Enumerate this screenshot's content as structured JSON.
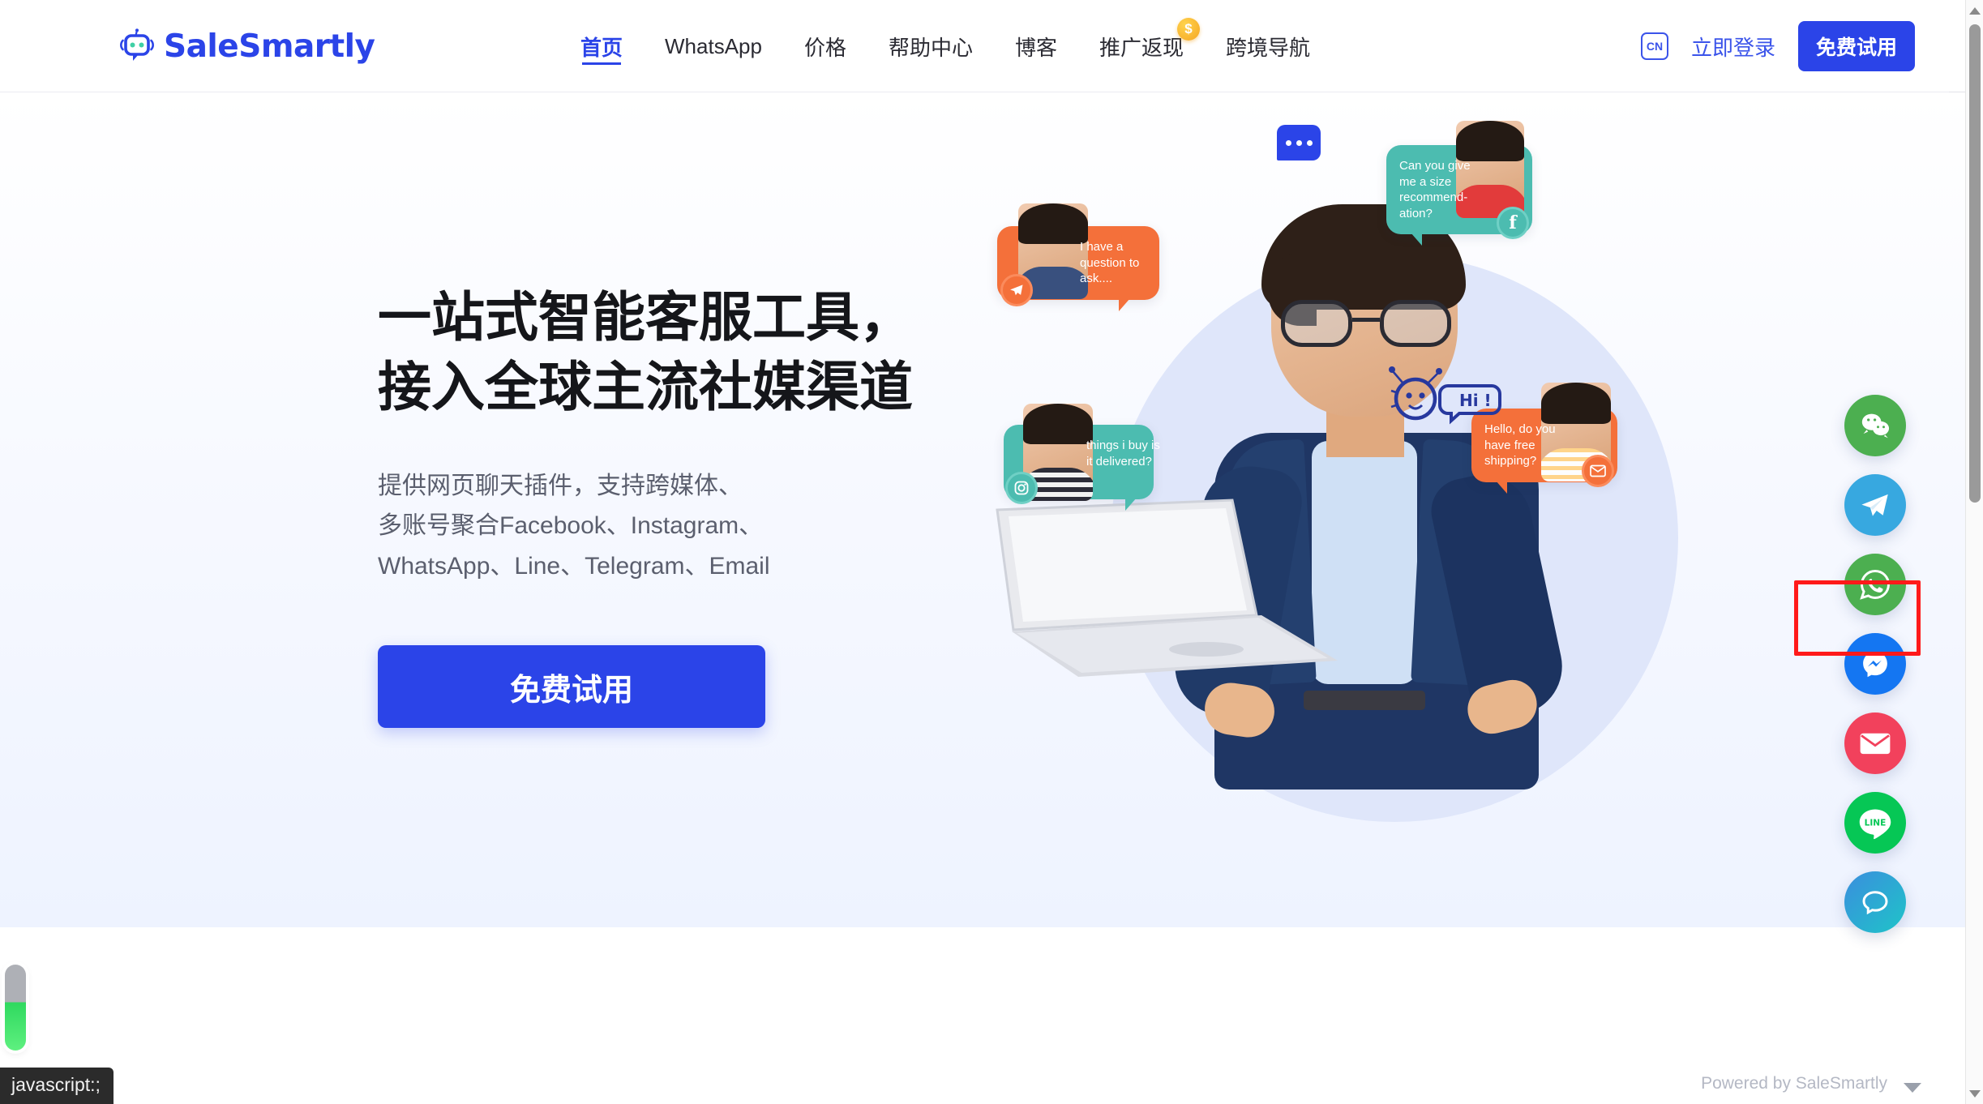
{
  "brand": {
    "name": "SaleSmartly",
    "logo_icon": "robot-logo-icon",
    "accent_color": "#2b44e8"
  },
  "header": {
    "nav": [
      {
        "label": "首页",
        "active": true,
        "badge": null
      },
      {
        "label": "WhatsApp",
        "active": false,
        "badge": null
      },
      {
        "label": "价格",
        "active": false,
        "badge": null
      },
      {
        "label": "帮助中心",
        "active": false,
        "badge": null
      },
      {
        "label": "博客",
        "active": false,
        "badge": null
      },
      {
        "label": "推广返现",
        "active": false,
        "badge": "$"
      },
      {
        "label": "跨境导航",
        "active": false,
        "badge": null
      }
    ],
    "language_label": "CN",
    "login_label": "立即登录",
    "trial_label": "免费试用"
  },
  "hero": {
    "title_line1": "一站式智能客服工具，",
    "title_line2": "接入全球主流社媒渠道",
    "sub_line1": "提供网页聊天插件，支持跨媒体、",
    "sub_line2": "多账号聚合Facebook、Instagram、",
    "sub_line3": "WhatsApp、Line、Telegram、Email",
    "cta_label": "免费试用",
    "bubbles": [
      {
        "id": "b1",
        "text": "I have a question to ask....",
        "color": "#f4703a",
        "channel": "telegram"
      },
      {
        "id": "b2",
        "text": "Can you give me a size recommend-ation?",
        "color": "#4cbcb0",
        "channel": "facebook"
      },
      {
        "id": "b3",
        "text": "things i buy is it delivered?",
        "color": "#4cbcb0",
        "channel": "instagram"
      },
      {
        "id": "b4",
        "text": "Hello, do you have free shipping?",
        "color": "#f4703a",
        "channel": "email"
      }
    ],
    "robot_greeting": "Hi !"
  },
  "social_rail": {
    "buttons": [
      {
        "name": "wechat",
        "icon": "wechat-icon",
        "color": "#4caf50",
        "highlighted": false
      },
      {
        "name": "telegram",
        "icon": "telegram-icon",
        "color": "#37a8e0",
        "highlighted": false
      },
      {
        "name": "whatsapp",
        "icon": "whatsapp-icon",
        "color": "#4caf50",
        "highlighted": true
      },
      {
        "name": "messenger",
        "icon": "messenger-icon",
        "color": "#1476f2",
        "highlighted": false
      },
      {
        "name": "email",
        "icon": "email-icon",
        "color": "#f2415c",
        "highlighted": false
      },
      {
        "name": "line",
        "icon": "line-icon",
        "color": "#06c755",
        "highlighted": false
      },
      {
        "name": "livechat",
        "icon": "chat-bubble-icon",
        "color": "#2ab7d6",
        "highlighted": false
      }
    ],
    "powered_by": "Powered by SaleSmartly",
    "collapse_icon": "chevron-down-icon"
  },
  "status_bar": {
    "text": "javascript:;"
  },
  "scrollbar": {
    "up_icon": "triangle-up-icon",
    "down_icon": "triangle-down-icon"
  }
}
